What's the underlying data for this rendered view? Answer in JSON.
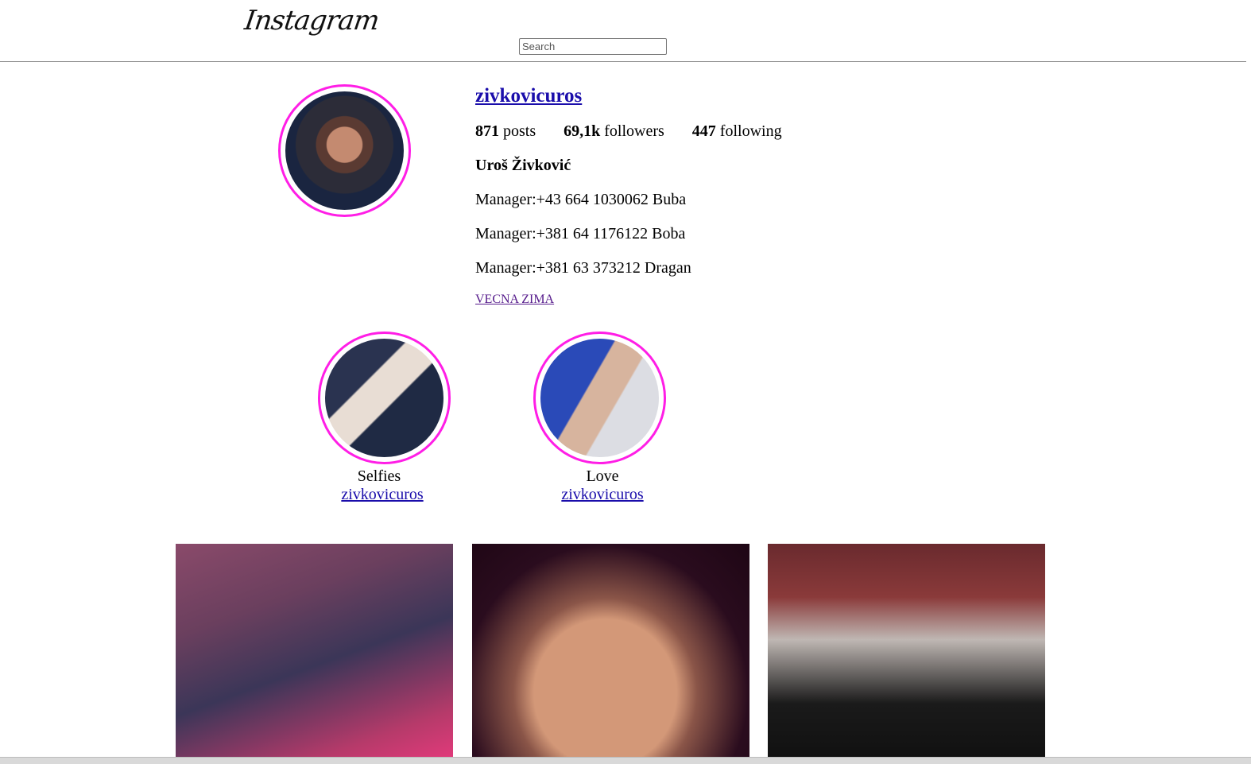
{
  "header": {
    "logo_text": "Instagram",
    "search_placeholder": "Search"
  },
  "profile": {
    "username": "zivkovicuros",
    "stats": [
      {
        "value": "871",
        "label": "posts"
      },
      {
        "value": "69,1k",
        "label": "followers"
      },
      {
        "value": "447",
        "label": "following"
      }
    ],
    "full_name": "Uroš Živković",
    "bio_lines": [
      "Manager:+43 664 1030062 Buba",
      "Manager:+381 64 1176122 Boba",
      "Manager:+381 63 373212 Dragan"
    ],
    "link_text": "VECNA ZIMA"
  },
  "highlights": [
    {
      "title": "Selfies",
      "user": "zivkovicuros"
    },
    {
      "title": "Love",
      "user": "zivkovicuros"
    }
  ],
  "colors": {
    "story_ring": "#ff1ee6",
    "link": "#1a0dab",
    "visited_link": "#551a8b"
  }
}
